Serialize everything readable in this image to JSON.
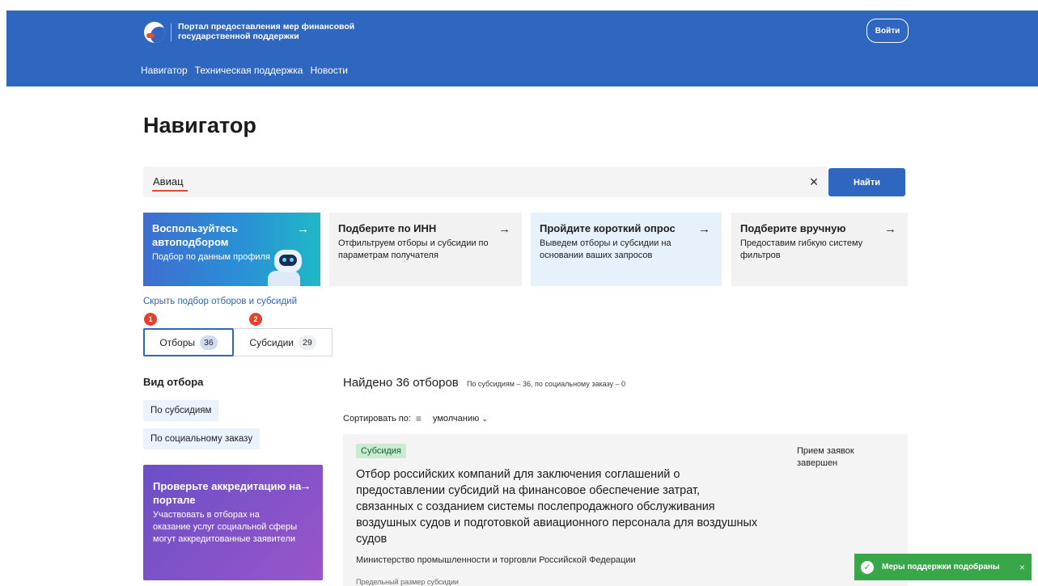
{
  "header": {
    "brand": "Портал предоставления мер финансовой государственной поддержки",
    "login": "Войти",
    "nav": [
      "Навигатор",
      "Техническая поддержка",
      "Новости"
    ]
  },
  "page_title": "Навигатор",
  "search": {
    "value": "Авиац",
    "button": "Найти"
  },
  "cards": [
    {
      "title": "Воспользуйтесь автоподбором",
      "desc": "Подбор по данным профиля"
    },
    {
      "title": "Подберите по ИНН",
      "desc": "Отфильтруем отборы и субсидии по параметрам получателя"
    },
    {
      "title": "Пройдите короткий опрос",
      "desc": "Выведем отборы и субсидии на основании ваших запросов"
    },
    {
      "title": "Подберите вручную",
      "desc": "Предоставим гибкую систему фильтров"
    }
  ],
  "toggle_link": "Скрыть подбор отборов и субсидий",
  "markers": [
    "1",
    "2"
  ],
  "tabs": [
    {
      "label": "Отборы",
      "count": "36"
    },
    {
      "label": "Субсидии",
      "count": "29"
    }
  ],
  "filter": {
    "title": "Вид отбора",
    "chips": [
      "По субсидиям",
      "По социальному заказу"
    ]
  },
  "promo": {
    "title": "Проверьте аккредитацию на портале",
    "desc": "Участвовать в отборах на оказание услуг социальной сферы могут аккредитованные заявители"
  },
  "results": {
    "found": "Найдено 36 отборов",
    "found_sub": "По субсидиям – 36, по социальному заказу – 0",
    "sort_label": "Сортировать по:",
    "sort_value": "умолчанию"
  },
  "result_card": {
    "tag": "Субсидия",
    "title": "Отбор российских компаний для заключения соглашений о предоставлении субсидий на финансовое обеспечение затрат, связанных с созданием системы послепродажного обслуживания воздушных судов и подготовкой авиационного персонала для воздушных судов",
    "org": "Министерство промышленности и торговли Российской Федерации",
    "status": "Прием заявок завершен",
    "more": "Предельный размер субсидии"
  },
  "toast": {
    "text": "Меры поддержки подобраны"
  },
  "colors": {
    "primary": "#2f66c0",
    "accent_red": "#e04b3a",
    "success": "#3aa64a",
    "promo": "#7a52c8"
  }
}
